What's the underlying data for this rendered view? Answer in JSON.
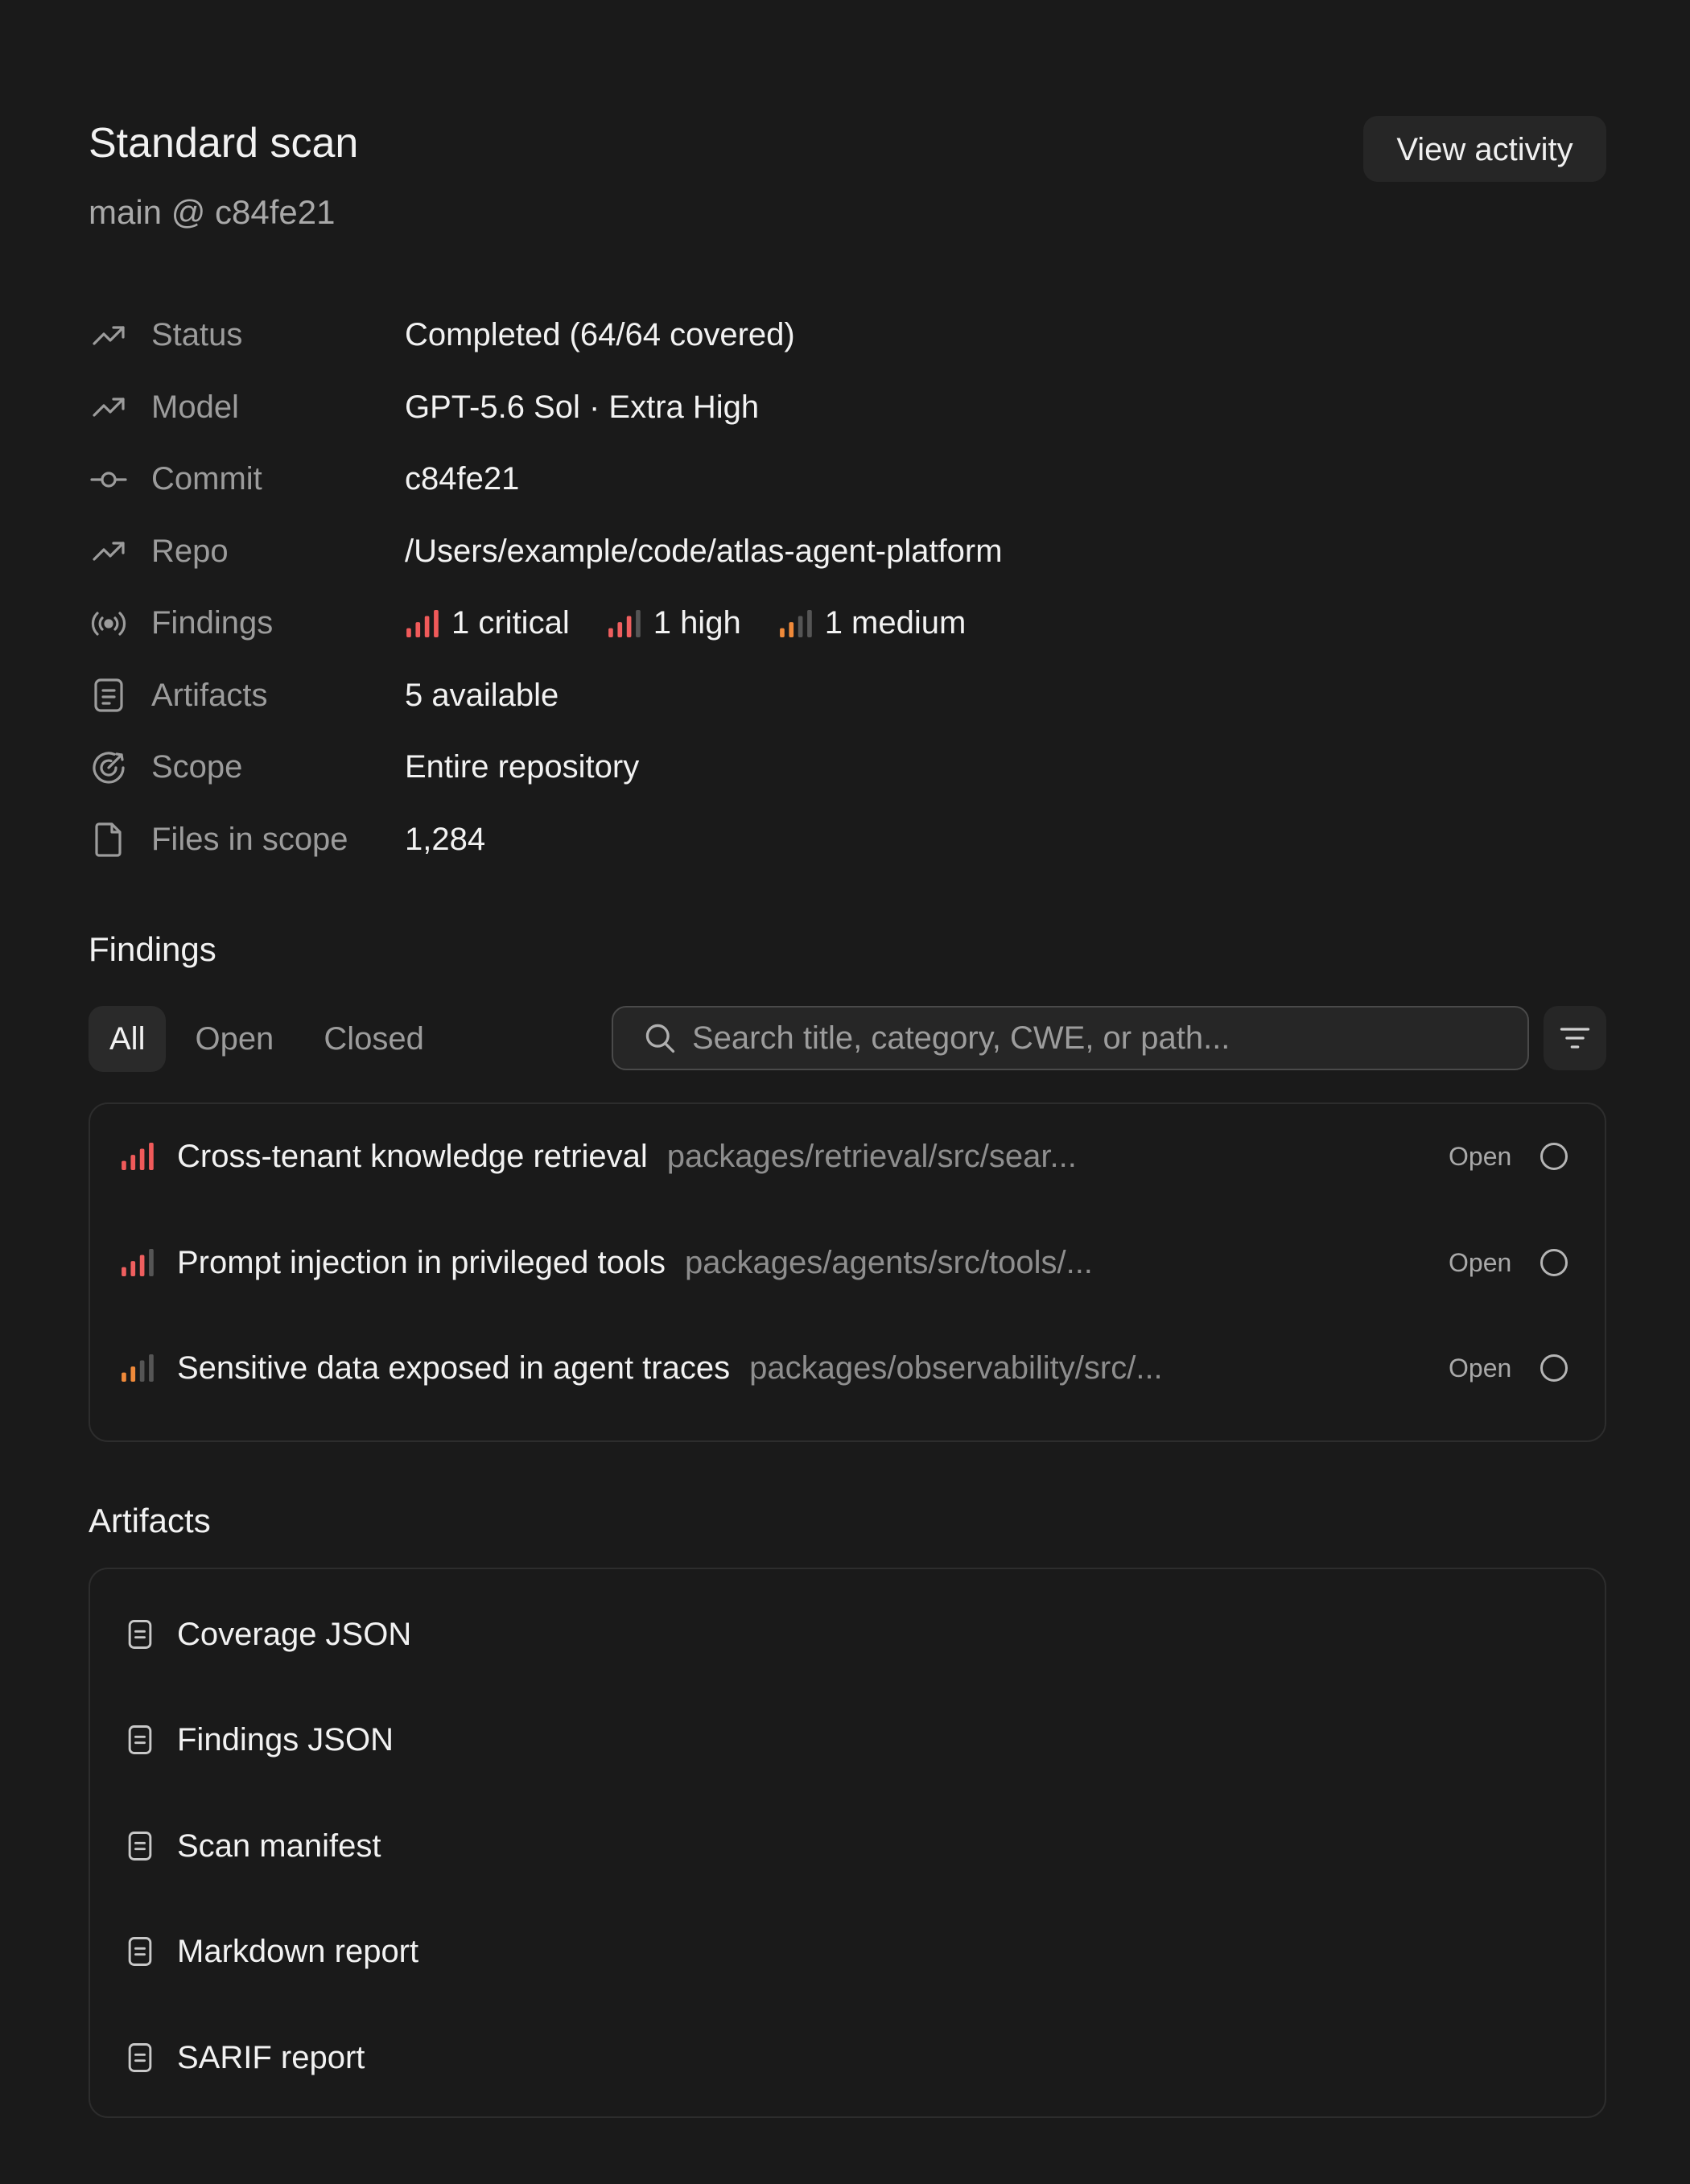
{
  "header": {
    "title": "Standard scan",
    "subtitle": "main @ c84fe21",
    "view_activity_label": "View activity"
  },
  "properties": {
    "status": {
      "label": "Status",
      "value": "Completed (64/64 covered)",
      "icon": "trend-up-icon"
    },
    "model": {
      "label": "Model",
      "value": "GPT-5.6 Sol · Extra High",
      "icon": "trend-up-icon"
    },
    "commit": {
      "label": "Commit",
      "value": "c84fe21",
      "icon": "commit-icon"
    },
    "repo": {
      "label": "Repo",
      "value": "/Users/example/code/atlas-agent-platform",
      "icon": "trend-up-icon"
    },
    "findings": {
      "label": "Findings",
      "icon": "broadcast-icon",
      "critical": "1 critical",
      "high": "1 high",
      "medium": "1 medium"
    },
    "artifacts": {
      "label": "Artifacts",
      "value": "5 available",
      "icon": "document-icon"
    },
    "scope": {
      "label": "Scope",
      "value": "Entire repository",
      "icon": "target-icon"
    },
    "files": {
      "label": "Files in scope",
      "value": "1,284",
      "icon": "file-icon"
    }
  },
  "findings_section": {
    "heading": "Findings",
    "tabs": {
      "all": "All",
      "open": "Open",
      "closed": "Closed"
    },
    "search_placeholder": "Search title, category, CWE, or path...",
    "items": [
      {
        "title": "Cross-tenant knowledge retrieval",
        "path": "packages/retrieval/src/sear...",
        "status": "Open",
        "severity": "critical"
      },
      {
        "title": "Prompt injection in privileged tools",
        "path": "packages/agents/src/tools/...",
        "status": "Open",
        "severity": "high"
      },
      {
        "title": "Sensitive data exposed in agent traces",
        "path": "packages/observability/src/...",
        "status": "Open",
        "severity": "medium"
      }
    ]
  },
  "artifacts_section": {
    "heading": "Artifacts",
    "items": [
      {
        "label": "Coverage JSON"
      },
      {
        "label": "Findings JSON"
      },
      {
        "label": "Scan manifest"
      },
      {
        "label": "Markdown report"
      },
      {
        "label": "SARIF report"
      }
    ]
  },
  "colors": {
    "background": "#1a1a1a",
    "critical": "#f05a5a",
    "high": "#ef5f5f",
    "medium": "#f08a3a",
    "muted_bar": "#555555"
  }
}
